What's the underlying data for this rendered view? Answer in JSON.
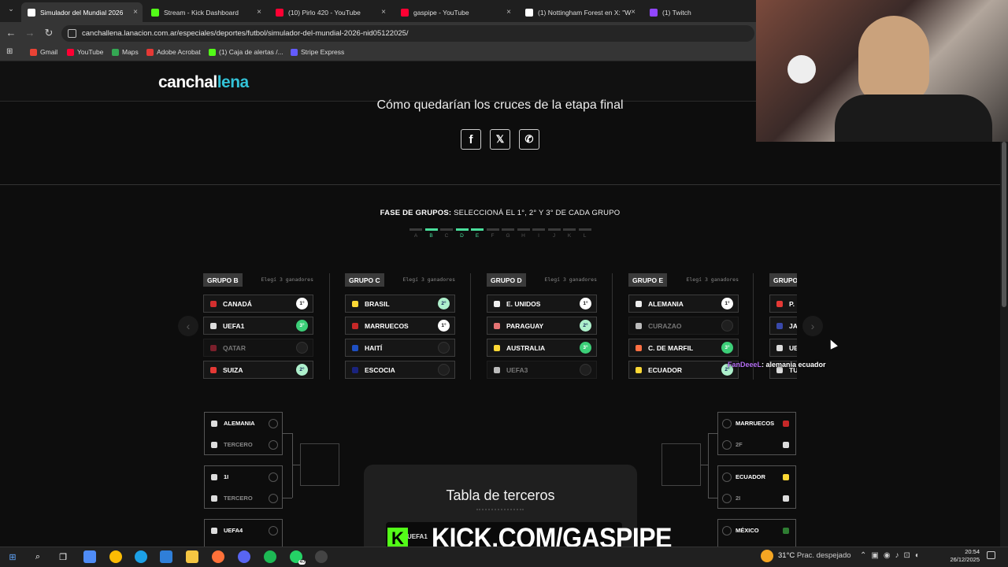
{
  "tabs": [
    {
      "label": "Simulador del Mundial 2026",
      "favicon": "lanacion-icon",
      "color": "#ffffff",
      "active": true
    },
    {
      "label": "Stream - Kick Dashboard",
      "favicon": "kick-icon",
      "color": "#53fc18"
    },
    {
      "label": "(10) Pirlo 420 - YouTube",
      "favicon": "youtube-icon",
      "color": "#ff0033"
    },
    {
      "label": "gaspipe - YouTube",
      "favicon": "youtube-icon",
      "color": "#ff0033"
    },
    {
      "label": "(1) Nottingham Forest en X: \"W",
      "favicon": "x-icon",
      "color": "#ffffff"
    },
    {
      "label": "(1) Twitch",
      "favicon": "twitch-icon",
      "color": "#9146ff"
    }
  ],
  "address": {
    "url": "canchallena.lanacion.com.ar/especiales/deportes/futbol/simulador-del-mundial-2026-nid05122025/"
  },
  "bookmarks": [
    {
      "label": "Gmail",
      "color": "#ea4335"
    },
    {
      "label": "YouTube",
      "color": "#ff0033"
    },
    {
      "label": "Maps",
      "color": "#34a853"
    },
    {
      "label": "Adobe Acrobat",
      "color": "#e53935"
    },
    {
      "label": "(1) Caja de alertas /...",
      "color": "#53fc18"
    },
    {
      "label": "Stripe Express",
      "color": "#635bff"
    }
  ],
  "site": {
    "logo_main": "canchal",
    "logo_accent": "lena",
    "heading": "Cómo quedarían los cruces de la etapa final",
    "share": [
      "f",
      "𝕏",
      "✆"
    ],
    "phase_label": "FASE DE GRUPOS:",
    "phase_text": " SELECCIONÁ EL 1°, 2° Y 3° DE CADA GRUPO",
    "progress": [
      {
        "letter": "A",
        "done": false
      },
      {
        "letter": "B",
        "done": true
      },
      {
        "letter": "C",
        "done": false
      },
      {
        "letter": "D",
        "done": true
      },
      {
        "letter": "E",
        "done": true
      },
      {
        "letter": "F",
        "done": false
      },
      {
        "letter": "G",
        "done": false
      },
      {
        "letter": "H",
        "done": false
      },
      {
        "letter": "I",
        "done": false
      },
      {
        "letter": "J",
        "done": false
      },
      {
        "letter": "K",
        "done": false
      },
      {
        "letter": "L",
        "done": false
      }
    ]
  },
  "groups": [
    {
      "name": "GRUPO B",
      "hint": "Elegí 3 ganadores",
      "teams": [
        {
          "name": "CANADÁ",
          "rank": "1°",
          "shirt": "#d32f2f",
          "dim": false
        },
        {
          "name": "UEFA1",
          "rank": "3°",
          "shirt": "#dddddd",
          "dim": false
        },
        {
          "name": "QATAR",
          "rank": "",
          "shirt": "#7a1f2b",
          "dim": true
        },
        {
          "name": "SUIZA",
          "rank": "2°",
          "shirt": "#e53935",
          "dim": false
        }
      ]
    },
    {
      "name": "GRUPO C",
      "hint": "Elegí 3 ganadores",
      "teams": [
        {
          "name": "BRASIL",
          "rank": "2°",
          "shirt": "#fdd835",
          "dim": false
        },
        {
          "name": "MARRUECOS",
          "rank": "1°",
          "shirt": "#c62828",
          "dim": false
        },
        {
          "name": "HAITÍ",
          "rank": "",
          "shirt": "#1e4fc2",
          "dim": false
        },
        {
          "name": "ESCOCIA",
          "rank": "",
          "shirt": "#1a237e",
          "dim": false
        }
      ]
    },
    {
      "name": "GRUPO D",
      "hint": "Elegí 3 ganadores",
      "teams": [
        {
          "name": "E. UNIDOS",
          "rank": "1°",
          "shirt": "#eeeeee",
          "dim": false
        },
        {
          "name": "PARAGUAY",
          "rank": "2°",
          "shirt": "#e57373",
          "dim": false
        },
        {
          "name": "AUSTRALIA",
          "rank": "3°",
          "shirt": "#fdd835",
          "dim": false
        },
        {
          "name": "UEFA3",
          "rank": "",
          "shirt": "#bbbbbb",
          "dim": true
        }
      ]
    },
    {
      "name": "GRUPO E",
      "hint": "Elegí 3 ganadores",
      "teams": [
        {
          "name": "ALEMANIA",
          "rank": "1°",
          "shirt": "#eeeeee",
          "dim": false
        },
        {
          "name": "CURAZAO",
          "rank": "",
          "shirt": "#bbbbbb",
          "dim": true
        },
        {
          "name": "C. DE MARFIL",
          "rank": "3°",
          "shirt": "#ff7043",
          "dim": false
        },
        {
          "name": "ECUADOR",
          "rank": "2°",
          "shirt": "#fdd835",
          "dim": false
        }
      ]
    },
    {
      "name": "GRUPO",
      "hint": "",
      "teams": [
        {
          "name": "P.",
          "rank": "",
          "shirt": "#e53935",
          "dim": false
        },
        {
          "name": "JA",
          "rank": "",
          "shirt": "#3949ab",
          "dim": false
        },
        {
          "name": "UE",
          "rank": "",
          "shirt": "#dddddd",
          "dim": false
        },
        {
          "name": "TU",
          "rank": "",
          "shirt": "#dddddd",
          "dim": false
        }
      ]
    }
  ],
  "bracket_left": [
    {
      "a": "ALEMANIA",
      "b": "TERCERO",
      "b_dim": true
    },
    {
      "a": "1I",
      "b": "TERCERO",
      "b_dim": true
    },
    {
      "a": "UEFA4",
      "b": "",
      "b_dim": true
    }
  ],
  "bracket_right": [
    {
      "a": "MARRUECOS",
      "b": "2F",
      "b_dim": true,
      "a_color": "#c62828"
    },
    {
      "a": "ECUADOR",
      "b": "2I",
      "b_dim": true,
      "a_color": "#fdd835"
    },
    {
      "a": "MÉXICO",
      "b": "",
      "b_dim": true,
      "a_color": "#2e7d32"
    }
  ],
  "overlay": {
    "terceros_title": "Tabla de terceros",
    "kick_logo": "K",
    "kick_text": "KICK.COM/GASPIPE",
    "behind_label": "UEFA1"
  },
  "chat": {
    "user": "FanDeeeL",
    "message": ": alemania ecuador"
  },
  "taskbar": {
    "weather_temp": "31°C",
    "weather_text": "Prac. despejado",
    "time": "20:54",
    "date": "26/12/2025",
    "badge": "40"
  }
}
